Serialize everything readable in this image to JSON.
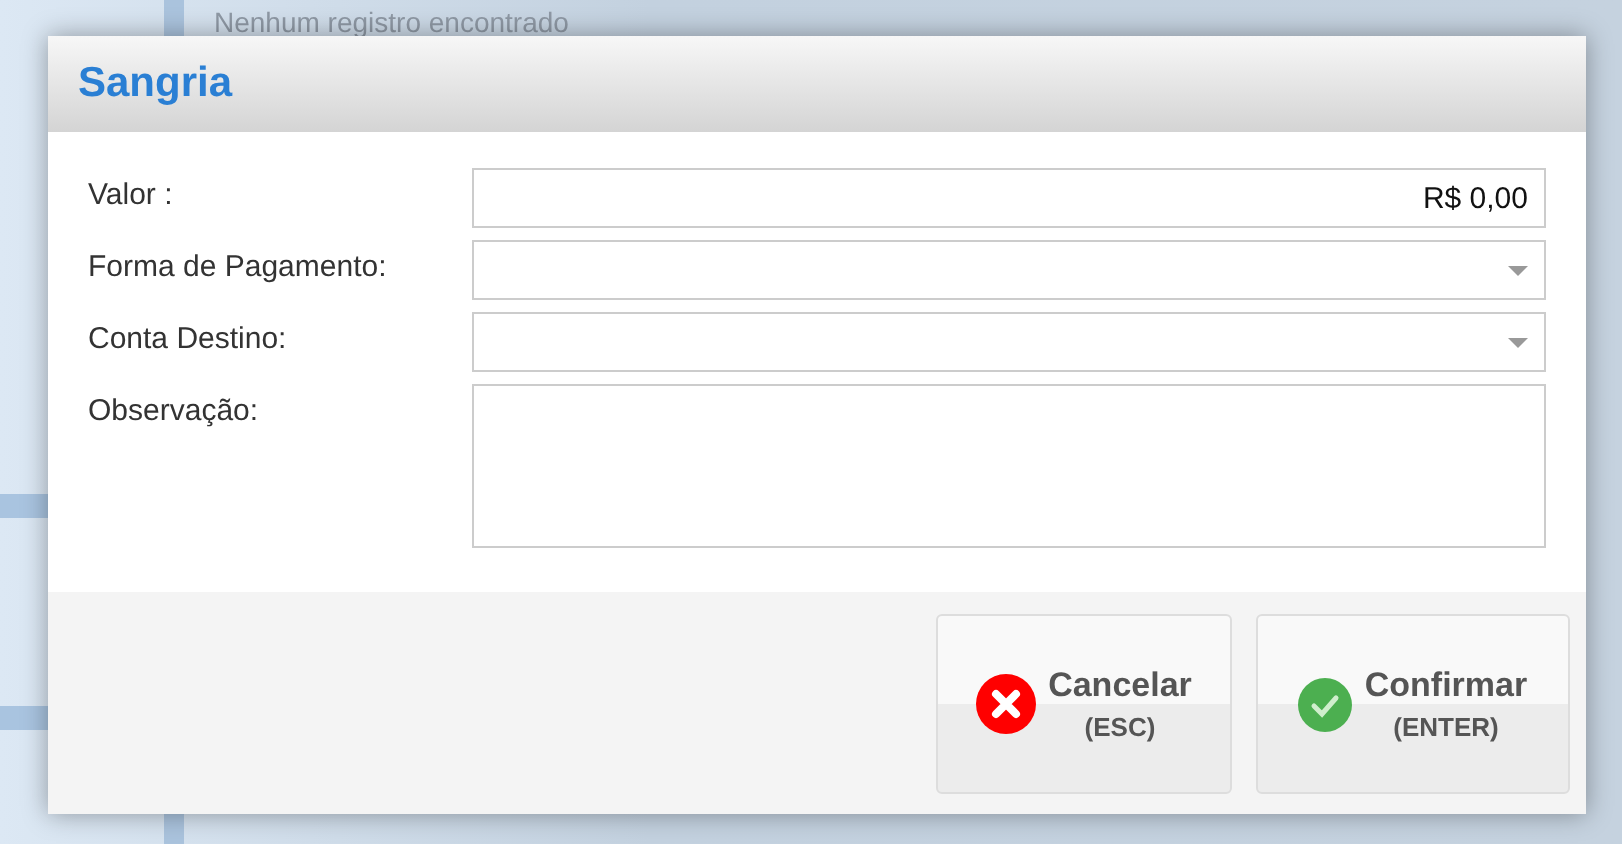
{
  "background": {
    "empty_message": "Nenhum registro encontrado"
  },
  "dialog": {
    "title": "Sangria",
    "fields": [
      {
        "label": "Valor :",
        "kind": "text",
        "value": "R$ 0,00"
      },
      {
        "label": "Forma de Pagamento:",
        "kind": "select"
      },
      {
        "label": "Conta Destino:",
        "kind": "select"
      },
      {
        "label": "Observação:",
        "kind": "textarea"
      }
    ],
    "buttons": [
      {
        "label": "Cancelar",
        "shortcut": "(ESC)",
        "kind": "cancel"
      },
      {
        "label": "Confirmar",
        "shortcut": "(ENTER)",
        "kind": "confirm"
      }
    ]
  }
}
